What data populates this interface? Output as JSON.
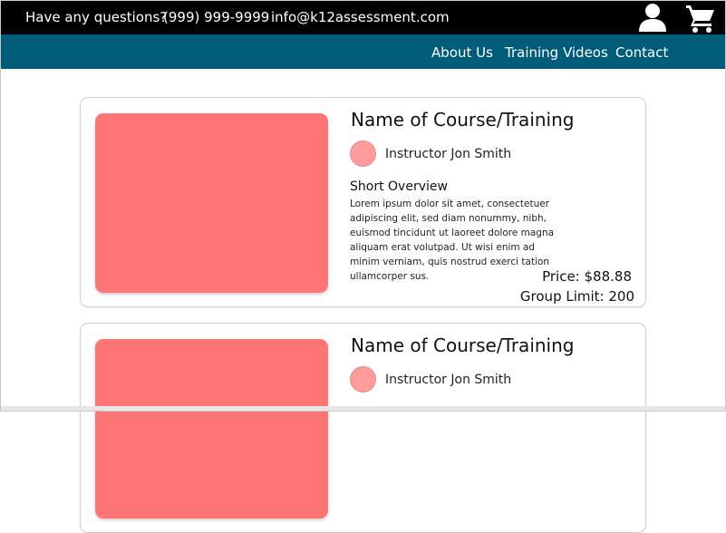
{
  "topbar": {
    "question_label": "Have any questions?",
    "phone": "(999) 999-9999",
    "email": "info@k12assessment.com"
  },
  "nav": {
    "items": [
      {
        "label": "About Us"
      },
      {
        "label": "Training Videos"
      },
      {
        "label": "Contact"
      }
    ]
  },
  "colors": {
    "topbar_bg": "#000000",
    "nav_bg": "#005c78",
    "card_image": "#ff7575",
    "avatar": "#ff9d9d"
  },
  "courses": [
    {
      "title": "Name of Course/Training",
      "instructor": "Instructor Jon Smith",
      "overview_heading": "Short Overview",
      "overview_text": "Lorem ipsum dolor sit amet, consectetuer adipiscing elit, sed diam nonummy, nibh, euismod tincidunt ut laoreet dolore magna aliquam erat volutpad. Ut wisi enim ad minim verniam, quis nostrud exerci tation ullamcorper sus.",
      "price": "Price: $88.88",
      "group_limit": "Group Limit: 200"
    },
    {
      "title": "Name of Course/Training",
      "instructor": "Instructor Jon Smith"
    }
  ]
}
